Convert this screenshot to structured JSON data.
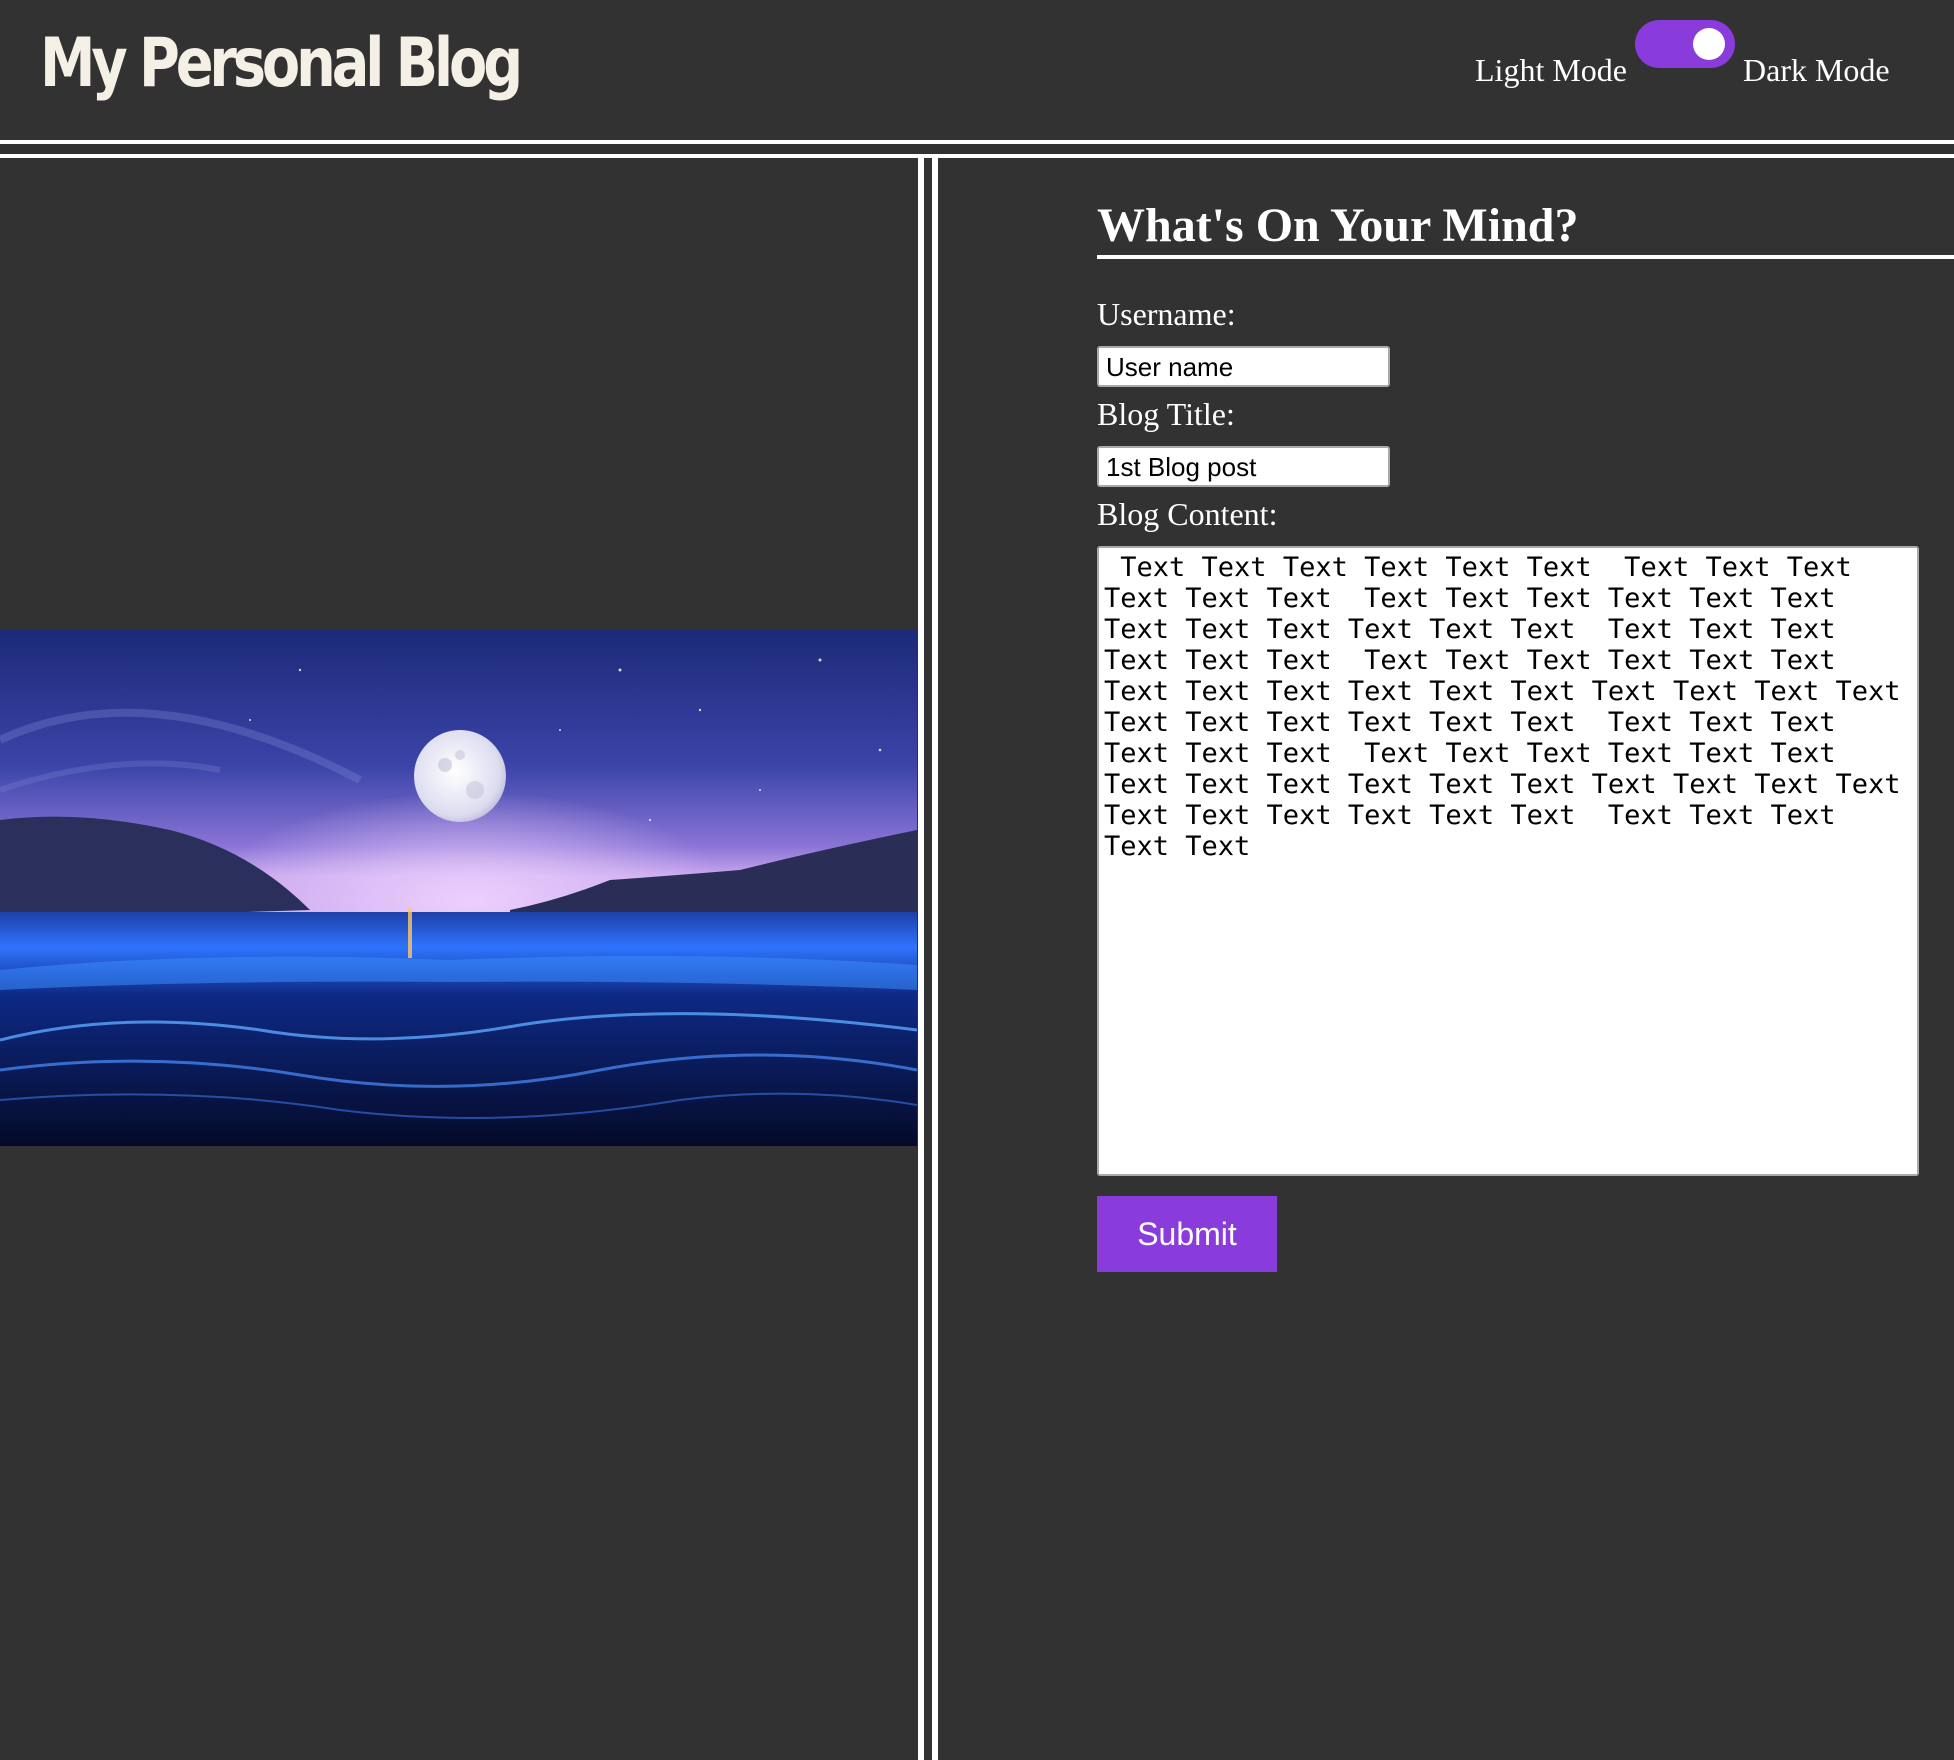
{
  "header": {
    "title": "My Personal Blog",
    "light_mode_label": "Light Mode",
    "dark_mode_label": "Dark Mode",
    "dark_mode_enabled": true
  },
  "hero_image": {
    "description_icon": "moonlit-bioluminescent-beach-image"
  },
  "form": {
    "heading": "What's On Your Mind?",
    "username_label": "Username:",
    "username_value": "User name",
    "title_label": "Blog Title:",
    "title_value": "1st Blog post",
    "content_label": "Blog Content:",
    "content_value": " Text Text Text Text Text Text  Text Text Text Text Text Text  Text Text Text Text Text Text Text Text Text Text Text Text  Text Text Text Text Text Text  Text Text Text Text Text Text  Text Text Text Text Text Text Text Text Text Text  Text Text Text Text Text Text  Text Text Text Text Text Text  Text Text Text Text Text Text  Text Text Text Text Text Text Text Text Text Text  Text Text Text Text Text Text  Text Text Text Text Text",
    "submit_label": "Submit"
  },
  "colors": {
    "background": "#323232",
    "accent": "#8a3bdb",
    "text": "#ffffff"
  }
}
